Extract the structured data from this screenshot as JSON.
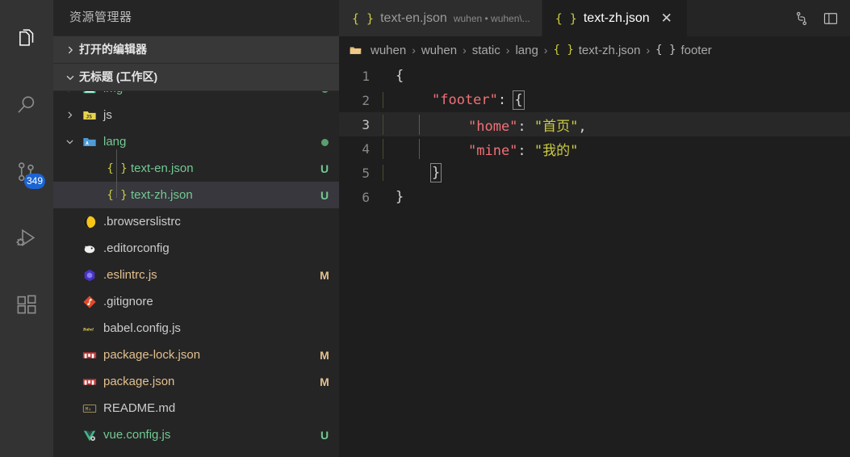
{
  "activity_bar": {
    "items": [
      {
        "name": "explorer",
        "icon": "files-icon",
        "active": true
      },
      {
        "name": "search",
        "icon": "search-icon",
        "active": false
      },
      {
        "name": "source-control",
        "icon": "source-control-icon",
        "active": false,
        "badge": "349"
      },
      {
        "name": "run-debug",
        "icon": "run-and-debug-icon",
        "active": false
      },
      {
        "name": "extensions",
        "icon": "extensions-icon",
        "active": false
      }
    ],
    "badge_color": "#1b64d4"
  },
  "sidebar": {
    "title": "资源管理器",
    "sections": [
      {
        "label": "打开的编辑器",
        "expanded": false
      },
      {
        "label": "无标题 (工作区)",
        "expanded": true
      }
    ],
    "tree": [
      {
        "label": "img",
        "indent": 1,
        "kind": "folder",
        "arrow": "collapsed",
        "icon": "image-folder-icon",
        "color": "#73c991",
        "deco": "",
        "deco_color": "#73c991",
        "dot": "#5a9e6f",
        "selected": false
      },
      {
        "label": "js",
        "indent": 1,
        "kind": "folder",
        "arrow": "collapsed",
        "icon": "js-folder-icon",
        "color": "#cccccc",
        "deco": "",
        "deco_color": "",
        "dot": "",
        "selected": false
      },
      {
        "label": "lang",
        "indent": 1,
        "kind": "folder",
        "arrow": "expanded",
        "icon": "lang-folder-icon",
        "color": "#73c991",
        "deco": "",
        "deco_color": "#73c991",
        "dot": "#5a9e6f",
        "selected": false
      },
      {
        "label": "text-en.json",
        "indent": 2,
        "kind": "file",
        "arrow": "none",
        "icon": "json-file-icon",
        "color": "#73c991",
        "deco": "U",
        "deco_color": "#73c991",
        "dot": "",
        "selected": false
      },
      {
        "label": "text-zh.json",
        "indent": 2,
        "kind": "file",
        "arrow": "none",
        "icon": "json-file-icon",
        "color": "#73c991",
        "deco": "U",
        "deco_color": "#73c991",
        "dot": "",
        "selected": true
      },
      {
        "label": ".browserslistrc",
        "indent": 1,
        "kind": "file",
        "arrow": "none",
        "icon": "browserslist-icon",
        "color": "#cccccc",
        "deco": "",
        "deco_color": "",
        "dot": "",
        "selected": false
      },
      {
        "label": ".editorconfig",
        "indent": 1,
        "kind": "file",
        "arrow": "none",
        "icon": "editorconfig-icon",
        "color": "#cccccc",
        "deco": "",
        "deco_color": "",
        "dot": "",
        "selected": false
      },
      {
        "label": ".eslintrc.js",
        "indent": 1,
        "kind": "file",
        "arrow": "none",
        "icon": "eslint-icon",
        "color": "#e2c08d",
        "deco": "M",
        "deco_color": "#e2c08d",
        "dot": "",
        "selected": false
      },
      {
        "label": ".gitignore",
        "indent": 1,
        "kind": "file",
        "arrow": "none",
        "icon": "git-icon",
        "color": "#cccccc",
        "deco": "",
        "deco_color": "",
        "dot": "",
        "selected": false
      },
      {
        "label": "babel.config.js",
        "indent": 1,
        "kind": "file",
        "arrow": "none",
        "icon": "babel-icon",
        "color": "#cccccc",
        "deco": "",
        "deco_color": "",
        "dot": "",
        "selected": false
      },
      {
        "label": "package-lock.json",
        "indent": 1,
        "kind": "file",
        "arrow": "none",
        "icon": "npm-icon",
        "color": "#e2c08d",
        "deco": "M",
        "deco_color": "#e2c08d",
        "dot": "",
        "selected": false
      },
      {
        "label": "package.json",
        "indent": 1,
        "kind": "file",
        "arrow": "none",
        "icon": "npm-icon",
        "color": "#e2c08d",
        "deco": "M",
        "deco_color": "#e2c08d",
        "dot": "",
        "selected": false
      },
      {
        "label": "README.md",
        "indent": 1,
        "kind": "file",
        "arrow": "none",
        "icon": "markdown-icon",
        "color": "#cccccc",
        "deco": "",
        "deco_color": "",
        "dot": "",
        "selected": false
      },
      {
        "label": "vue.config.js",
        "indent": 1,
        "kind": "file",
        "arrow": "none",
        "icon": "vue-icon",
        "color": "#73c991",
        "deco": "U",
        "deco_color": "#73c991",
        "dot": "",
        "selected": false
      }
    ]
  },
  "tabs": {
    "items": [
      {
        "name": "text-en.json",
        "description": "wuhen • wuhen\\...",
        "icon": "json-file-icon",
        "active": false,
        "closable": false
      },
      {
        "name": "text-zh.json",
        "description": "",
        "icon": "json-file-icon",
        "active": true,
        "closable": true,
        "close_label": "✕"
      }
    ],
    "actions": [
      {
        "name": "split-editor-right-icon",
        "label": "split-editor"
      },
      {
        "name": "toggle-panel-icon",
        "label": "toggle-layout"
      }
    ]
  },
  "breadcrumb": {
    "icon": "folder-open-icon",
    "items": [
      {
        "label": "wuhen",
        "icon": ""
      },
      {
        "label": "wuhen",
        "icon": ""
      },
      {
        "label": "static",
        "icon": ""
      },
      {
        "label": "lang",
        "icon": ""
      },
      {
        "label": "text-zh.json",
        "icon": "json-symbol-yellow"
      },
      {
        "label": "footer",
        "icon": "json-symbol-grey"
      }
    ],
    "separator": "›"
  },
  "editor": {
    "language": "json",
    "current_line": 3,
    "lines": [
      {
        "num": "1",
        "tokens": [
          {
            "t": "{",
            "c": "p"
          }
        ],
        "indent": 0
      },
      {
        "num": "2",
        "tokens": [
          {
            "t": "\"footer\"",
            "c": "key"
          },
          {
            "t": ": ",
            "c": "p"
          },
          {
            "t": "{",
            "c": "bracket"
          }
        ],
        "indent": 1
      },
      {
        "num": "3",
        "tokens": [
          {
            "t": "\"home\"",
            "c": "key"
          },
          {
            "t": ": ",
            "c": "p"
          },
          {
            "t": "\"首页\"",
            "c": "s"
          },
          {
            "t": ",",
            "c": "p"
          }
        ],
        "indent": 2
      },
      {
        "num": "4",
        "tokens": [
          {
            "t": "\"mine\"",
            "c": "key"
          },
          {
            "t": ": ",
            "c": "p"
          },
          {
            "t": "\"我的\"",
            "c": "s"
          }
        ],
        "indent": 2
      },
      {
        "num": "5",
        "tokens": [
          {
            "t": "}",
            "c": "bracket"
          }
        ],
        "indent": 1
      },
      {
        "num": "6",
        "tokens": [
          {
            "t": "}",
            "c": "p"
          }
        ],
        "indent": 0
      }
    ]
  },
  "colors": {
    "activitybar_bg": "#333333",
    "sidebar_bg": "#252526",
    "section_header_bg": "#383838",
    "editor_bg": "#1e1e1e",
    "tab_active_bg": "#1e1e1e",
    "tab_inactive_bg": "#2d2d2d",
    "selection_bg": "#37373d",
    "current_line_bg": "#282828",
    "badge_bg": "#1b64d4",
    "untracked_green": "#73c991",
    "modified_tan": "#e2c08d",
    "json_key_red": "#f07178",
    "json_string_yellow": "#cbcb41"
  }
}
